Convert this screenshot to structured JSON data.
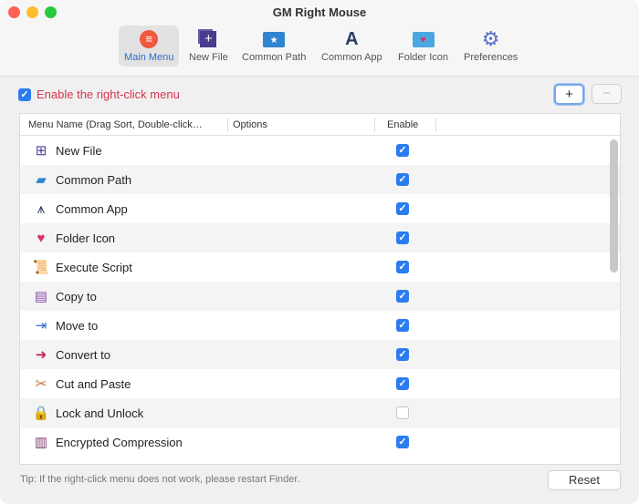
{
  "window": {
    "title": "GM Right Mouse"
  },
  "toolbar": [
    {
      "label": "Main Menu",
      "icon": "main-menu-icon",
      "active": true
    },
    {
      "label": "New File",
      "icon": "new-file-icon"
    },
    {
      "label": "Common Path",
      "icon": "common-path-icon"
    },
    {
      "label": "Common App",
      "icon": "common-app-icon"
    },
    {
      "label": "Folder Icon",
      "icon": "folder-icon-icon"
    },
    {
      "label": "Preferences",
      "icon": "gear-icon"
    }
  ],
  "enable_label": "Enable the right-click menu",
  "add_label": "+",
  "remove_label": "−",
  "columns": {
    "name": "Menu Name (Drag Sort, Double-click…",
    "options": "Options",
    "enable": "Enable"
  },
  "rows": [
    {
      "name": "New File",
      "icon": "new-file-icon",
      "glyph": "⊞",
      "color": "#4b3b8f",
      "enabled": true
    },
    {
      "name": "Common Path",
      "icon": "folder-star-icon",
      "glyph": "▰",
      "color": "#2f86d0",
      "enabled": true
    },
    {
      "name": "Common App",
      "icon": "app-store-icon",
      "glyph": "⩚",
      "color": "#2b3a6a",
      "enabled": true
    },
    {
      "name": "Folder Icon",
      "icon": "folder-heart-icon",
      "glyph": "♥",
      "color": "#d8336f",
      "enabled": true
    },
    {
      "name": "Execute Script",
      "icon": "script-icon",
      "glyph": "📜",
      "color": "#e08a3a",
      "enabled": true
    },
    {
      "name": "Copy to",
      "icon": "copy-icon",
      "glyph": "▤",
      "color": "#8a4fa8",
      "enabled": true
    },
    {
      "name": "Move to",
      "icon": "move-icon",
      "glyph": "⇥",
      "color": "#2b6ad0",
      "enabled": true
    },
    {
      "name": "Convert to",
      "icon": "convert-icon",
      "glyph": "➜",
      "color": "#c8265a",
      "enabled": true
    },
    {
      "name": "Cut and Paste",
      "icon": "scissors-icon",
      "glyph": "✂",
      "color": "#d06a2a",
      "enabled": true
    },
    {
      "name": "Lock and Unlock",
      "icon": "lock-icon",
      "glyph": "🔒",
      "color": "#111111",
      "enabled": false
    },
    {
      "name": "Encrypted Compression",
      "icon": "archive-icon",
      "glyph": "▥",
      "color": "#7a3a6a",
      "enabled": true
    }
  ],
  "tip": "Tip: If the right-click menu does not work, please restart Finder.",
  "reset_label": "Reset"
}
